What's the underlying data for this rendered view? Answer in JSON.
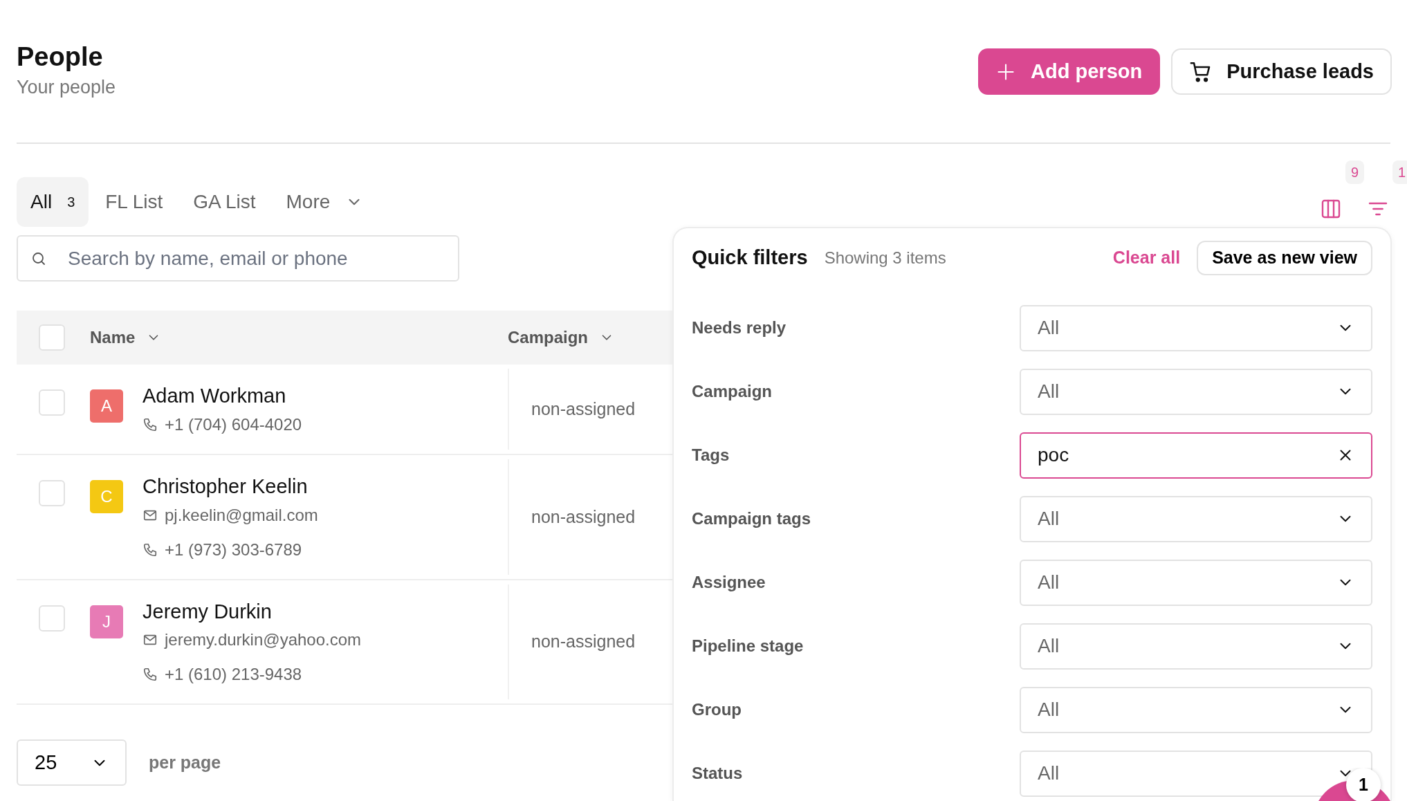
{
  "header": {
    "title": "People",
    "subtitle": "Your people"
  },
  "actions": [
    {
      "label": "Add person",
      "kind": "primary"
    },
    {
      "label": "Purchase leads",
      "kind": "outline"
    }
  ],
  "tabs": [
    {
      "label": "All",
      "count": "3",
      "selected": true
    },
    {
      "label": "FL List",
      "selected": false
    },
    {
      "label": "GA List",
      "selected": false
    },
    {
      "label": "More",
      "selected": false,
      "kind": "dropdown"
    }
  ],
  "toolbar": {
    "columns_count": "9",
    "filters_count": "1"
  },
  "search": {
    "placeholder": "Search by name, email or phone"
  },
  "table": {
    "select_all_checked": false,
    "columns": [
      "Name",
      "Campaign"
    ],
    "rows": [
      {
        "initial": "A",
        "color": "#ee6e6b",
        "name": "Adam Workman",
        "checked": false,
        "campaign": "non-assigned",
        "contacts": [
          {
            "kind": "phone",
            "text": "+1 (704) 604-4020"
          }
        ]
      },
      {
        "initial": "C",
        "color": "#f4c813",
        "name": "Christopher Keelin",
        "checked": false,
        "campaign": "non-assigned",
        "contacts": [
          {
            "kind": "email",
            "text": "pj.keelin@gmail.com"
          },
          {
            "kind": "phone",
            "text": "+1 (973) 303-6789"
          }
        ]
      },
      {
        "initial": "J",
        "color": "#e77bb5",
        "name": "Jeremy Durkin",
        "checked": false,
        "campaign": "non-assigned",
        "contacts": [
          {
            "kind": "email",
            "text": "jeremy.durkin@yahoo.com"
          },
          {
            "kind": "phone",
            "text": "+1 (610) 213-9438"
          }
        ]
      }
    ]
  },
  "pagination": {
    "per_page": "25",
    "label": "per page"
  },
  "filters": {
    "title": "Quick filters",
    "summary": "Showing 3 items",
    "clear": "Clear all",
    "save": "Save as new view",
    "items": [
      {
        "label": "Needs reply",
        "value": "All",
        "kind": "select"
      },
      {
        "label": "Campaign",
        "value": "All",
        "kind": "select"
      },
      {
        "label": "Tags",
        "value": "poc",
        "kind": "text"
      },
      {
        "label": "Campaign tags",
        "value": "All",
        "kind": "select"
      },
      {
        "label": "Assignee",
        "value": "All",
        "kind": "select"
      },
      {
        "label": "Pipeline stage",
        "value": "All",
        "kind": "select"
      },
      {
        "label": "Group",
        "value": "All",
        "kind": "select"
      },
      {
        "label": "Status",
        "value": "All",
        "kind": "select"
      }
    ]
  },
  "chat": {
    "badge": "1"
  }
}
